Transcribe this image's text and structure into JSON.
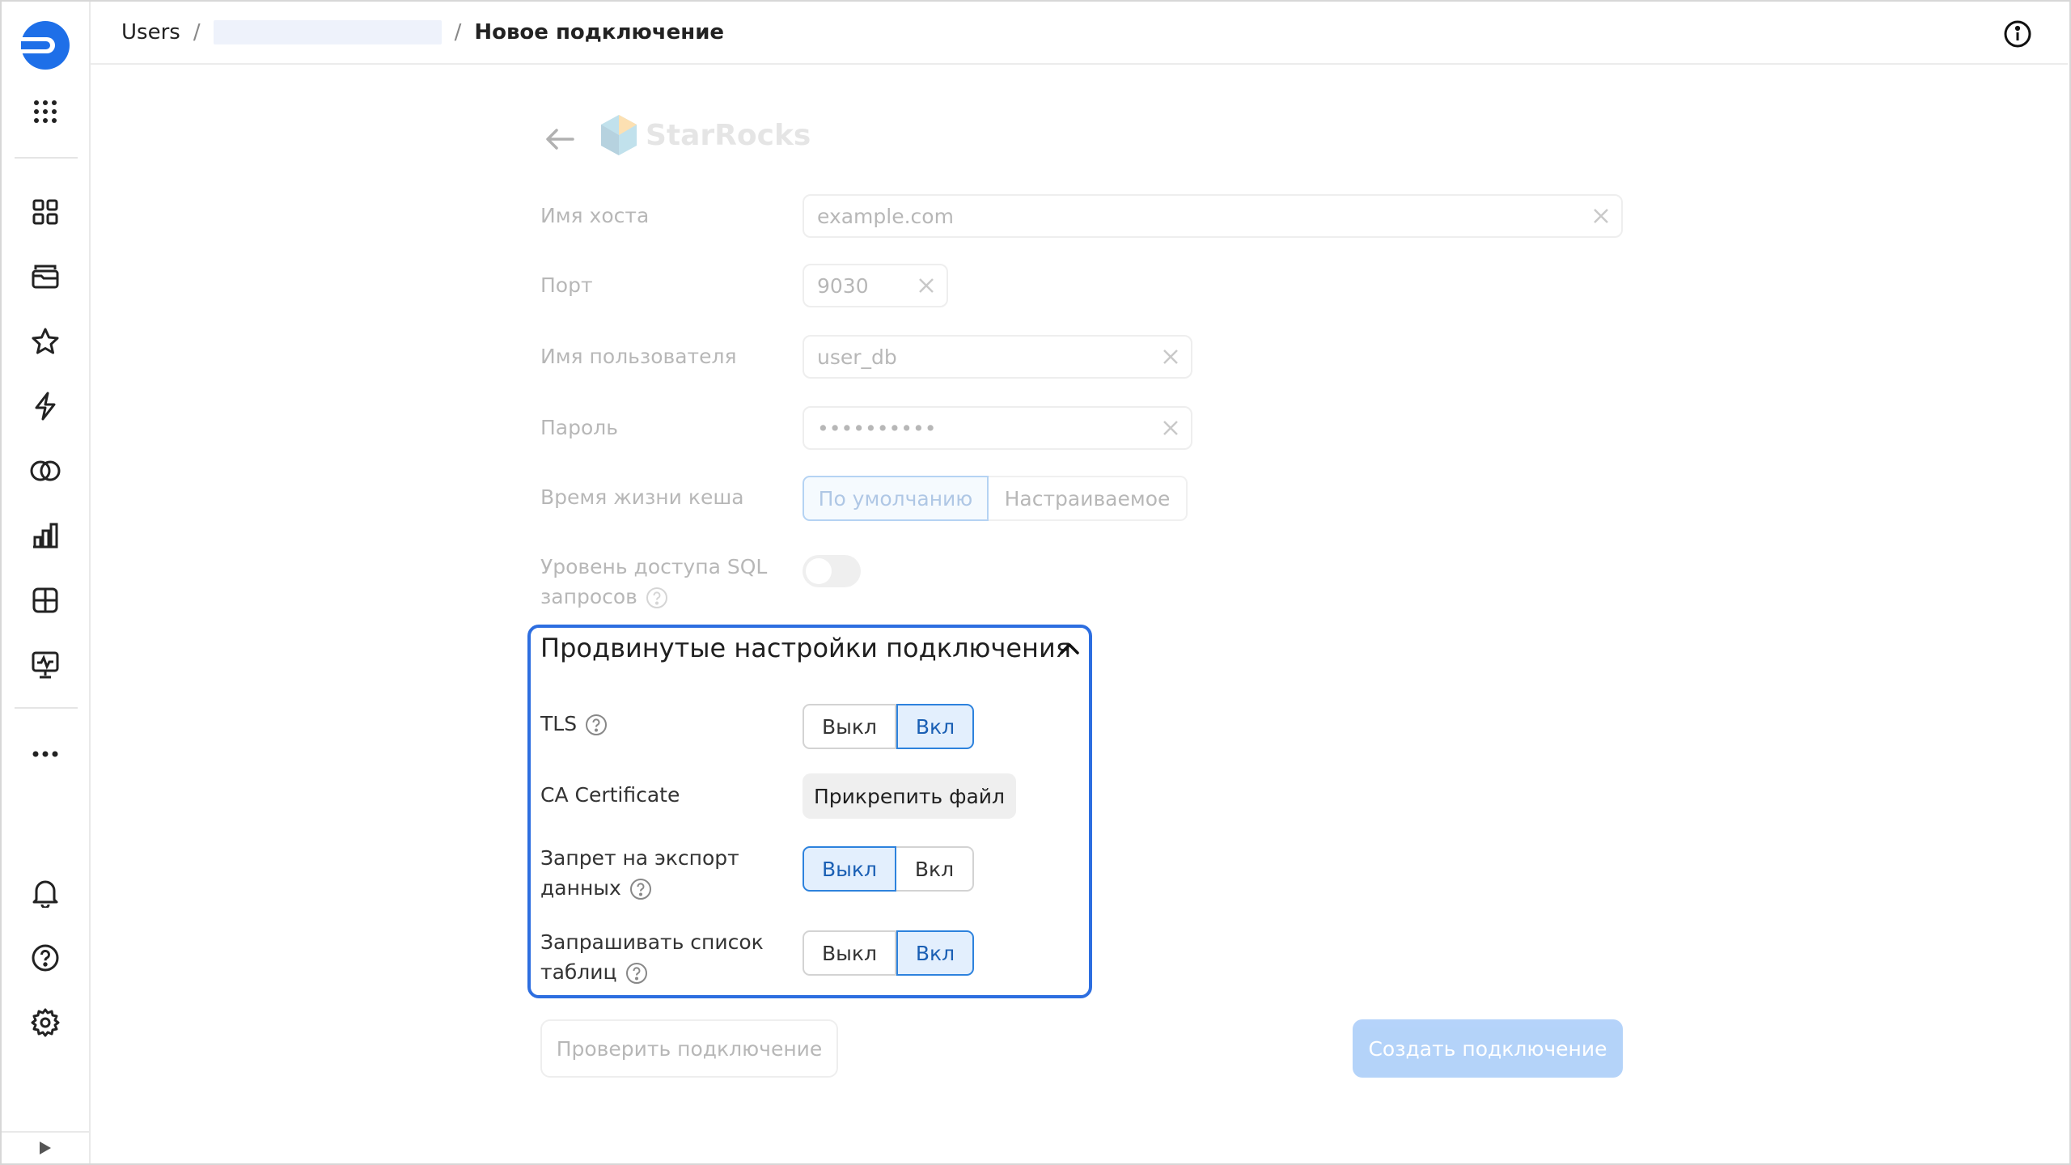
{
  "header": {
    "breadcrumbs": [
      "Users",
      "Новое подключение"
    ],
    "separator": "/"
  },
  "connector": {
    "name": "StarRocks"
  },
  "form": {
    "host": {
      "label": "Имя хоста",
      "value": "example.com"
    },
    "port": {
      "label": "Порт",
      "value": "9030"
    },
    "user": {
      "label": "Имя пользователя",
      "value": "user_db"
    },
    "password": {
      "label": "Пароль",
      "value": "••••••••••"
    },
    "cache": {
      "label": "Время жизни кеша",
      "options": [
        "По умолчанию",
        "Настраиваемое"
      ],
      "selected": "По умолчанию"
    },
    "sql_level": {
      "label_line1": "Уровень доступа SQL",
      "label_line2": "запросов",
      "enabled": false
    }
  },
  "advanced": {
    "title": "Продвинутые настройки подключения",
    "tls": {
      "label": "TLS",
      "options": [
        "Выкл",
        "Вкл"
      ],
      "selected": "Вкл"
    },
    "ca": {
      "label": "CA Certificate",
      "button": "Прикрепить файл"
    },
    "export": {
      "label_line1": "Запрет на экспорт",
      "label_line2": "данных",
      "options": [
        "Выкл",
        "Вкл"
      ],
      "selected": "Выкл"
    },
    "tables": {
      "label_line1": "Запрашивать список",
      "label_line2": "таблиц",
      "options": [
        "Выкл",
        "Вкл"
      ],
      "selected": "Вкл"
    }
  },
  "actions": {
    "check": "Проверить подключение",
    "create": "Создать подключение"
  },
  "colors": {
    "accent": "#2d6ee0",
    "brand": "#1e6fe8",
    "selected_bg": "#e3effd",
    "primary_button": "#2b82f0"
  }
}
